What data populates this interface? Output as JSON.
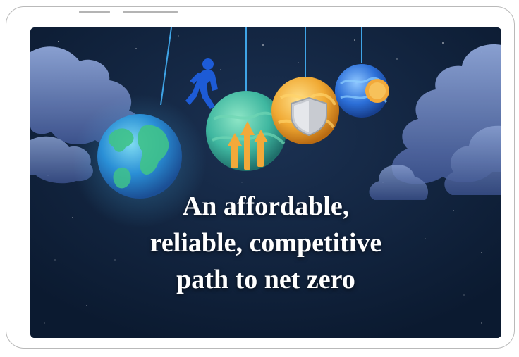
{
  "hero": {
    "headline_lines": [
      "An affordable,",
      "reliable, competitive",
      "path to net zero"
    ]
  },
  "colors": {
    "background": "#0e1d35",
    "text": "#ffffff",
    "earth": "#2a8fd6",
    "green_sphere": "#3fb7a0",
    "gold_sphere": "#f0a933",
    "blue_sphere": "#2c6fd8",
    "figure": "#1d5bd6"
  },
  "icons": {
    "figure": "walking-person-icon",
    "arrows": "growth-arrows-icon",
    "shield": "shield-icon",
    "coin": "coin-icon"
  }
}
